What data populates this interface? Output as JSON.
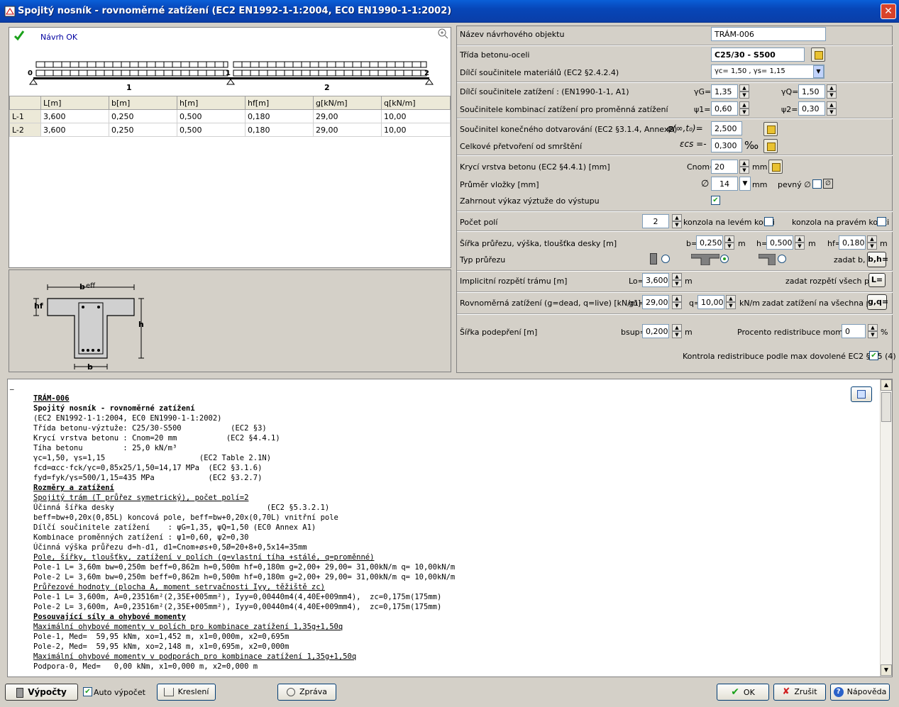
{
  "window": {
    "title": "Spojitý nosník - rovnoměrné zatížení (EC2 EN1992-1-1:2004, EC0 EN1990-1-1:2002)",
    "close": "✕"
  },
  "status": {
    "text": "Návrh OK"
  },
  "spans_table": {
    "headers": [
      "",
      "L[m]",
      "b[m]",
      "h[m]",
      "hf[m]",
      "g[kN/m]",
      "q[kN/m]"
    ],
    "rows": [
      [
        "L-1",
        "3,600",
        "0,250",
        "0,500",
        "0,180",
        "29,00",
        "10,00"
      ],
      [
        "L-2",
        "3,600",
        "0,250",
        "0,500",
        "0,180",
        "29,00",
        "10,00"
      ]
    ]
  },
  "beam_diagram": {
    "supports": [
      "0",
      "1",
      "2"
    ],
    "spans": [
      "1",
      "2"
    ]
  },
  "section_diagram": {
    "beff": "b",
    "beff_sub": "eff",
    "hf": "hf",
    "h": "h",
    "b": "b"
  },
  "form": {
    "object_name_label": "Název návrhového objektu",
    "object_name": "TRÁM-006",
    "concrete_label": "Třída betonu-oceli",
    "concrete": "C25/30 - S500",
    "material_factors_label": "Dílčí součinitele materiálů (EC2 §2.4.2.4)",
    "material_factors": "γc= 1,50 , γs= 1,15",
    "load_factors_label": "Dílčí součinitele zatížení   : (EN1990-1-1, A1)",
    "gammaG_label": "γG=",
    "gammaG": "1,35",
    "gammaQ_label": "γQ=",
    "gammaQ": "1,50",
    "combo_label": "Součinitele kombinací zatížení pro proměnná zatížení",
    "psi1_label": "ψ1=",
    "psi1": "0,60",
    "psi2_label": "ψ2=",
    "psi2": "0,30",
    "creep_label": "Součinitel konečného dotvarování (EC2 §3.1.4, AnnexB)",
    "creep_sym": "φ(∞,t₀)=",
    "creep": "2,500",
    "shrink_label": "Celkové přetvoření od smrštění",
    "shrink_sym": "εcs =-",
    "shrink": "0,300",
    "shrink_unit": "‰",
    "cover_label": "Krycí vrstva betonu (EC2 §4.4.1) [mm]",
    "cnom_label": "Cnom=",
    "cnom": "20",
    "mm1": "mm",
    "stirrup_label": "Průměr vložky [mm]",
    "dia_sym": "∅",
    "dia": "14",
    "mm2": "mm",
    "fixed_label": "pevný ∅",
    "fixed_sym": "∅",
    "include_label": "Zahrnout výkaz výztuže do výstupu",
    "nspans_label": "Počet polí",
    "nspans": "2",
    "left_cant": "konzola na levém konci",
    "right_cant": "konzola na pravém konci",
    "dims_label": "Šířka průřezu, výška, tloušťka desky [m]",
    "b_lbl": "b=",
    "b_val": "0,250",
    "h_lbl": "h=",
    "h_val": "0,500",
    "hf_lbl": "hf=",
    "hf_val": "0,180",
    "m": "m",
    "set_bh_label": "zadat b, h",
    "set_bh_btn": "b,h=",
    "section_type_label": "Typ průřezu",
    "span_label": "Implicitní rozpětí trámu [m]",
    "lo_lbl": "Lo=",
    "lo_val": "3,600",
    "set_span_label": "zadat rozpětí všech polí",
    "set_span_btn": "L=",
    "load_label": "Rovnoměrná zatížení (g=dead, q=live) [kN/m]",
    "g1_lbl": "g1=",
    "g1_val": "29,00",
    "q_lbl": "q=",
    "q_val": "10,00",
    "knm": "kN/m",
    "set_load_label": "zadat zatížení na všechna pole",
    "set_load_btn": "g,q=",
    "support_label": "Šířka podepření [m]",
    "bsup_lbl": "bsup=",
    "bsup_val": "0,200",
    "redist_label": "Procento redistribuce momentů",
    "redist_val": "0",
    "pct": "%",
    "redist_check_label": "Kontrola redistribuce podle max dovolené EC2  §5.5 (4)"
  },
  "report": {
    "marker": "_",
    "lines": [
      {
        "t": "TRÁM-006",
        "s": "bu"
      },
      {
        "t": "Spojitý nosník - rovnoměrné zatížení",
        "s": "b"
      },
      {
        "t": "(EC2 EN1992-1-1:2004, EC0 EN1990-1-1:2002)",
        "s": ""
      },
      {
        "t": "Třída betonu-výztuže: C25/30-S500           (EC2 §3)",
        "s": ""
      },
      {
        "t": "Krycí vrstva betonu : Cnom=20 mm           (EC2 §4.4.1)",
        "s": ""
      },
      {
        "t": "Tíha betonu         : 25,0 kN/m³",
        "s": ""
      },
      {
        "t": "γc=1,50, γs=1,15                     (EC2 Table 2.1N)",
        "s": ""
      },
      {
        "t": "fcd=αcc·fck/γc=0,85x25/1,50=14,17 MPa  (EC2 §3.1.6)",
        "s": ""
      },
      {
        "t": "fyd=fyk/γs=500/1,15=435 MPa            (EC2 §3.2.7)",
        "s": ""
      },
      {
        "t": "Rozměry a zatížení",
        "s": "bu"
      },
      {
        "t": "Spojitý trám (T průřez symetrický), počet polí=2",
        "s": "u"
      },
      {
        "t": "Účinná šířka desky                                  (EC2 §5.3.2.1)",
        "s": ""
      },
      {
        "t": "beff=bw+0,20x(0,85L) koncová pole, beff=bw+0,20x(0,70L) vnitřní pole",
        "s": ""
      },
      {
        "t": "Dílčí součinitele zatížení    : ψG=1,35, ψQ=1,50 (EC0 Annex A1)",
        "s": ""
      },
      {
        "t": "Kombinace proměnných zatížení : ψ1=0,60, ψ2=0,30",
        "s": ""
      },
      {
        "t": "Účinná výška průřezu d=h-d1, d1=Cnom+øs+0,5Ø=20+8+0,5x14=35mm",
        "s": ""
      },
      {
        "t": "Pole, šířky, tloušťky, zatížení v polích (g=vlastní tíha +stálé, q=proměnné)",
        "s": "u"
      },
      {
        "t": "Pole-1 L= 3,60m bw=0,250m beff=0,862m h=0,500m hf=0,180m g=2,00+ 29,00= 31,00kN/m q= 10,00kN/m",
        "s": ""
      },
      {
        "t": "Pole-2 L= 3,60m bw=0,250m beff=0,862m h=0,500m hf=0,180m g=2,00+ 29,00= 31,00kN/m q= 10,00kN/m",
        "s": ""
      },
      {
        "t": "Průřezové hodnoty (plocha A, moment setrvačnosti Iyy, těžiště zc)",
        "s": "u"
      },
      {
        "t": "Pole-1 L= 3,600m, A=0,23516m²(2,35E+005mm²), Iyy=0,00440m4(4,40E+009mm4),  zc=0,175m(175mm)",
        "s": ""
      },
      {
        "t": "Pole-2 L= 3,600m, A=0,23516m²(2,35E+005mm²), Iyy=0,00440m4(4,40E+009mm4),  zc=0,175m(175mm)",
        "s": ""
      },
      {
        "t": "Posouvající síly a ohybové momenty",
        "s": "bu"
      },
      {
        "t": "Maximální ohybové momenty v polích pro kombinace zatížení 1,35g+1,50q",
        "s": "u"
      },
      {
        "t": "Pole-1, Med=  59,95 kNm, xo=1,452 m, x1=0,000m, x2=0,695m",
        "s": ""
      },
      {
        "t": "Pole-2, Med=  59,95 kNm, xo=2,148 m, x1=0,695m, x2=0,000m",
        "s": ""
      },
      {
        "t": "Maximální ohybové momenty v podporách pro kombinace zatížení 1,35g+1,50q",
        "s": "u"
      },
      {
        "t": "Podpora-0, Med=   0,00 kNm, x1=0,000 m, x2=0,000 m",
        "s": ""
      }
    ]
  },
  "buttons": {
    "calc": "Výpočty",
    "auto": "Auto výpočet",
    "draw": "Kreslení",
    "report": "Zpráva",
    "ok": "OK",
    "cancel": "Zrušit",
    "help": "Nápověda"
  }
}
